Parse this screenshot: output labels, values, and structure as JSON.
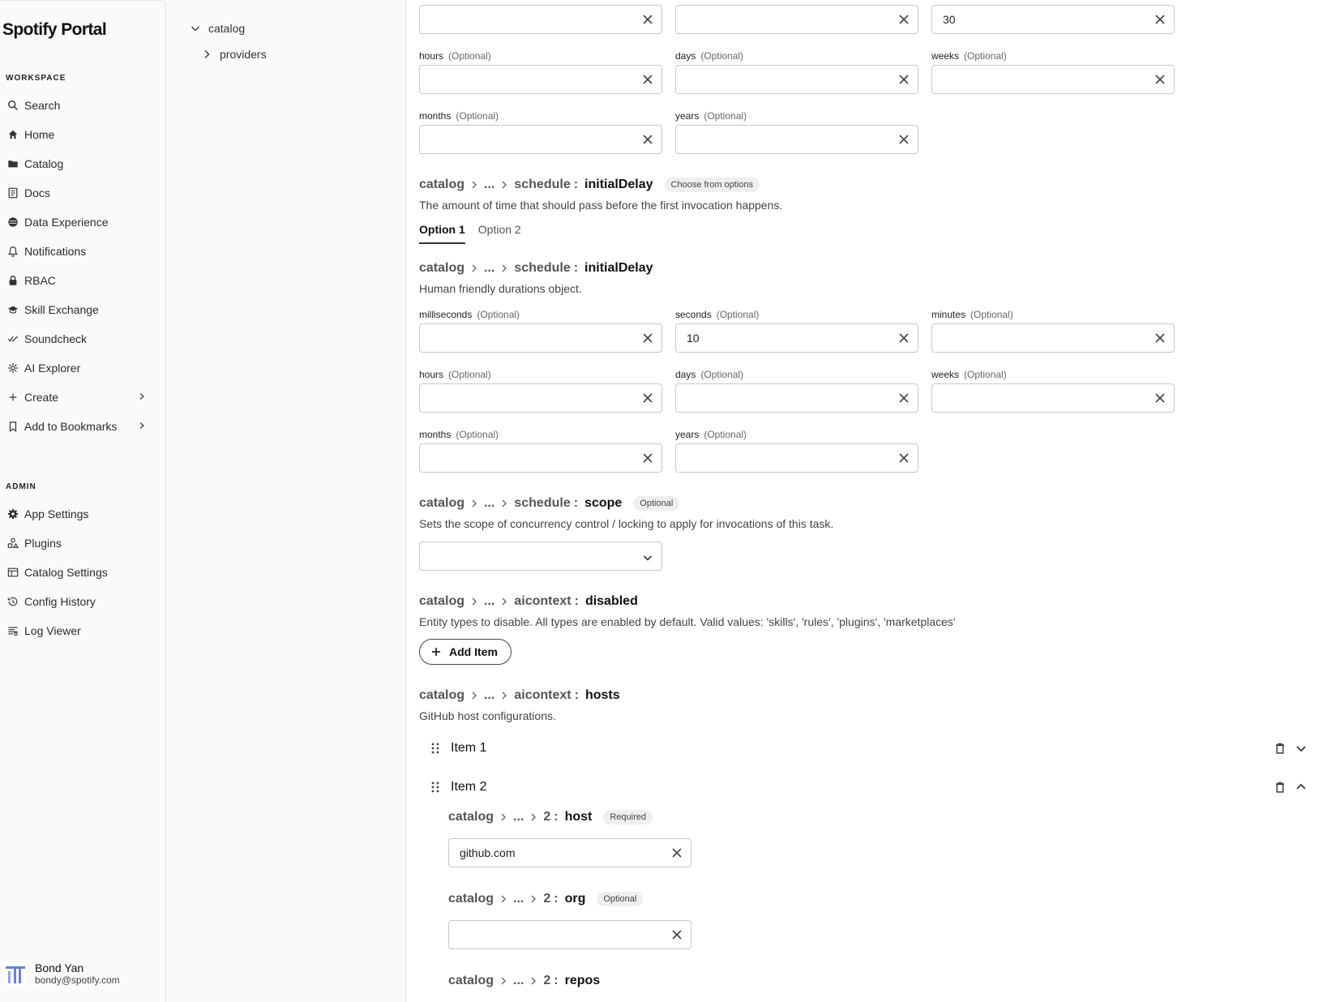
{
  "app": {
    "title": "Spotify Portal"
  },
  "sidebar": {
    "workspace_label": "WORKSPACE",
    "workspace_items": [
      {
        "label": "Search",
        "icon": "search-icon"
      },
      {
        "label": "Home",
        "icon": "home-icon"
      },
      {
        "label": "Catalog",
        "icon": "folder-icon"
      },
      {
        "label": "Docs",
        "icon": "docs-icon"
      },
      {
        "label": "Data Experience",
        "icon": "data-icon"
      },
      {
        "label": "Notifications",
        "icon": "bell-icon"
      },
      {
        "label": "RBAC",
        "icon": "lock-icon"
      },
      {
        "label": "Skill Exchange",
        "icon": "graduation-cap-icon"
      },
      {
        "label": "Soundcheck",
        "icon": "check-icon"
      },
      {
        "label": "AI Explorer",
        "icon": "sparkle-icon"
      },
      {
        "label": "Create",
        "icon": "plus-icon"
      },
      {
        "label": "Add to Bookmarks",
        "icon": "bookmark-icon"
      }
    ],
    "admin_label": "ADMIN",
    "admin_items": [
      {
        "label": "App Settings",
        "icon": "gear-icon"
      },
      {
        "label": "Plugins",
        "icon": "plugins-icon"
      },
      {
        "label": "Catalog Settings",
        "icon": "catalog-settings-icon"
      },
      {
        "label": "Config History",
        "icon": "history-icon"
      },
      {
        "label": "Log Viewer",
        "icon": "log-icon"
      }
    ],
    "user": {
      "name": "Bond Yan",
      "email": "bondy@spotify.com"
    }
  },
  "tree": {
    "root": "catalog",
    "child": "providers"
  },
  "common": {
    "optional": "(Optional)",
    "catalog": "catalog",
    "ellipsis": "...",
    "colon": ":"
  },
  "top_group": {
    "hours": "hours",
    "days": "days",
    "weeks": "weeks",
    "months": "months",
    "years": "years",
    "third_top_value": "30"
  },
  "initial_delay": {
    "crumb_key": "schedule",
    "key": "initialDelay",
    "tag": "Choose from options",
    "desc": "The amount of time that should pass before the first invocation happens.",
    "tabs": [
      "Option 1",
      "Option 2"
    ],
    "sub_desc": "Human friendly durations object.",
    "fields": {
      "milliseconds": "milliseconds",
      "seconds": "seconds",
      "minutes": "minutes",
      "hours": "hours",
      "days": "days",
      "weeks": "weeks",
      "months": "months",
      "years": "years"
    },
    "seconds_value": "10"
  },
  "scope": {
    "crumb_key": "schedule",
    "key": "scope",
    "tag": "Optional",
    "desc": "Sets the scope of concurrency control / locking to apply for invocations of this task."
  },
  "disabled": {
    "crumb_key": "aicontext",
    "key": "disabled",
    "desc": "Entity types to disable. All types are enabled by default. Valid values: 'skills', 'rules', 'plugins', 'marketplaces'",
    "add_label": "Add Item"
  },
  "hosts": {
    "crumb_key": "aicontext",
    "key": "hosts",
    "desc": "GitHub host configurations.",
    "items": [
      "Item 1",
      "Item 2"
    ],
    "index": "2",
    "host": {
      "key": "host",
      "tag": "Required",
      "value": "github.com"
    },
    "org": {
      "key": "org",
      "tag": "Optional",
      "value": ""
    },
    "repos": {
      "key": "repos"
    }
  }
}
